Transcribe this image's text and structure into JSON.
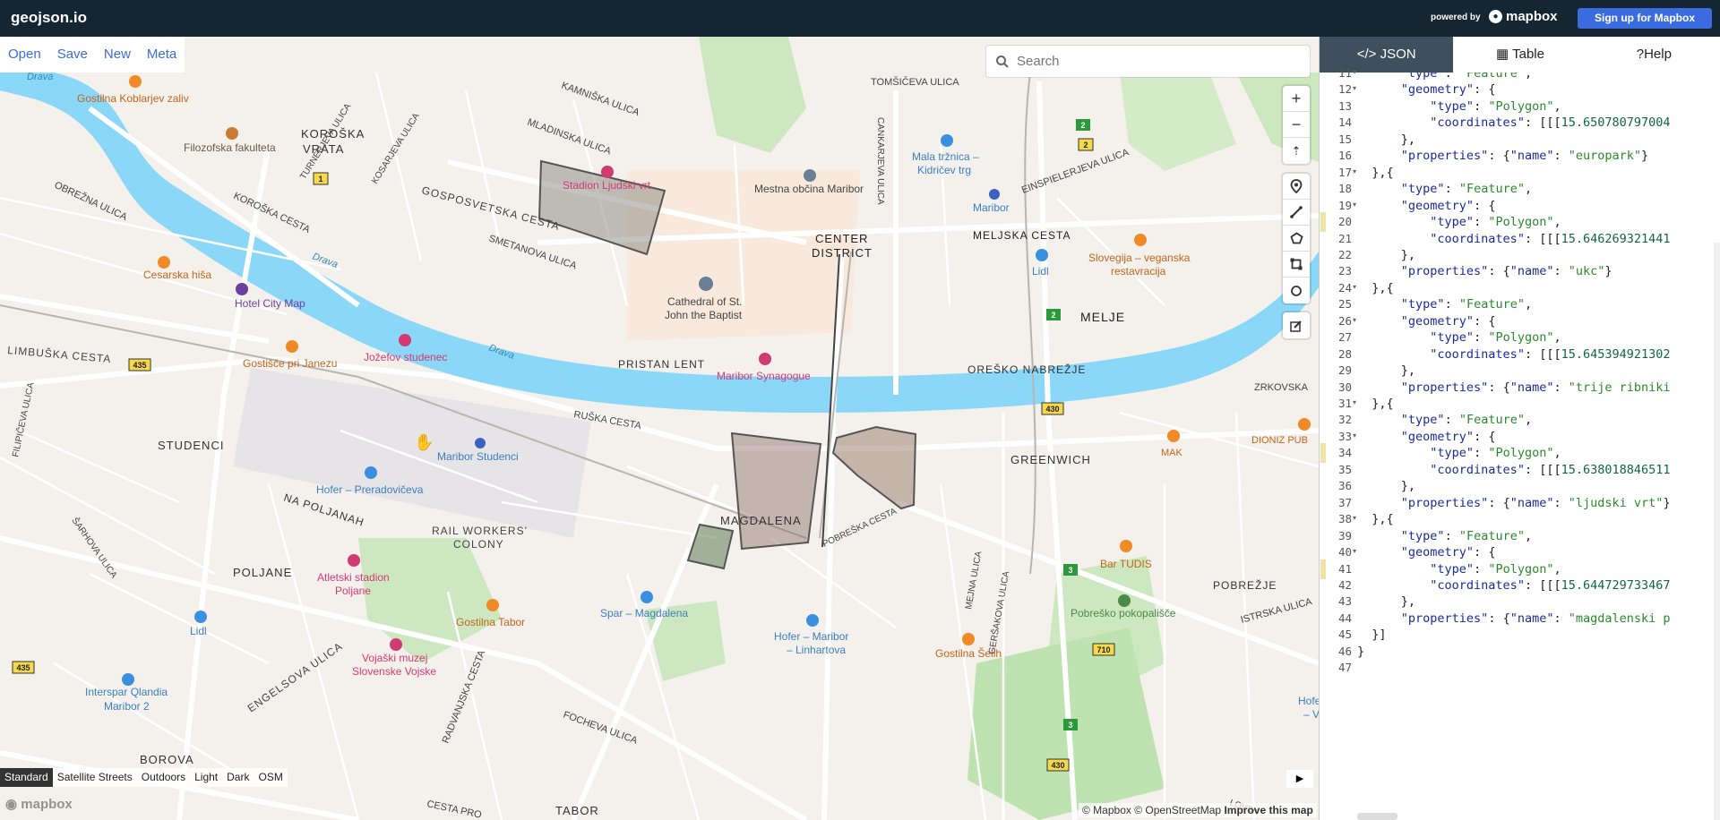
{
  "topbar": {
    "app_title": "geojson.io",
    "powered_by": "powered by",
    "brand": "mapbox",
    "signup_label": "Sign up for Mapbox"
  },
  "file_menu": [
    "Open",
    "Save",
    "New",
    "Meta"
  ],
  "search": {
    "placeholder": "Search"
  },
  "map_controls": {
    "zoom": [
      "+",
      "−",
      "⇡"
    ],
    "draw": [
      "marker-icon",
      "line-icon",
      "polygon-icon",
      "rectangle-icon",
      "circle-icon"
    ],
    "edit": [
      "edit-icon"
    ]
  },
  "map_styles": [
    "Standard",
    "Satellite Streets",
    "Outdoors",
    "Light",
    "Dark",
    "OSM"
  ],
  "attribution": {
    "mapbox": "© Mapbox",
    "osm": "© OpenStreetMap",
    "improve": "Improve this map"
  },
  "watermark": "mapbox",
  "map_labels": [
    "Drava",
    "Gostilna Koblarjev zaliv",
    "Filozofska fakulteta",
    "KOROŠKA",
    "VRATA",
    "TURNERJEVA ULICA",
    "KOSARJEVA ULICA",
    "MLADINSKA ULICA",
    "KAMNIŠKA ULICA",
    "Stadion Ljudski vrt",
    "TOMŠIČEVA ULICA",
    "CANKARJEVA ULICA",
    "Mala tržnica –",
    "Kidričev trg",
    "EINSPIELERJEVA ULICA",
    "Mestna občina Maribor",
    "Maribor",
    "OBREŽNA ULICA",
    "KOROŠKA CESTA",
    "GOSPOSVETSKA CESTA",
    "SMETANOVA ULICA",
    "CENTER",
    "DISTRICT",
    "MELJSKA CESTA",
    "Slovegija – veganska",
    "restavracija",
    "Lidl",
    "Cesarska hiša",
    "Hotel City Map",
    "Cathedral of St.",
    "John the Baptist",
    "MELJE",
    "LIMBUŠKA CESTA",
    "Gostišče pri Janezu",
    "Jožefov studenec",
    "PRISTAN LENT",
    "Maribor Synagogue",
    "OREŠKO NABREŽJE",
    "ZRKOVSKA",
    "RUŠKA CESTA",
    "STUDENCI",
    "Maribor Studenci",
    "DIONIZ PUB",
    "GREENWICH",
    "MAK",
    "Hofer – Preradovičeva",
    "NA POLJANAH",
    "MAGDALENA",
    "POBREŠKA CESTA",
    "RAIL WORKERS'",
    "COLONY",
    "Bar TUDIS",
    "POLJANE",
    "Atletski stadion",
    "Poljane",
    "Gostilna Tabor",
    "Spar – Magdalena",
    "Pobreško pokopališče",
    "POBREŽJE",
    "ISTRSKA ULICA",
    "Lidl",
    "ENGELSOVA ULICA",
    "Hofer – Maribor",
    "– Linhartova",
    "Gostilna Šelih",
    "Vojaški muzej",
    "Slovenske Vojske",
    "Interspar Qlandia",
    "Maribor 2",
    "FOCHEVA ULICA",
    "RADVANJSKA CESTA",
    "BOROVA",
    "TABOR",
    "CESTA PRO",
    "Drava",
    "Drava",
    "FILIPIČEVA ULICA",
    "ŠARHOVA ULICA",
    "MEJNA ULICA",
    "GERŠAKOVA ULICA",
    "Hofe",
    "– V",
    "LOVSK"
  ],
  "road_shields": [
    "1",
    "2",
    "2",
    "2",
    "435",
    "430",
    "3",
    "710",
    "3",
    "430",
    "435"
  ],
  "panel": {
    "tabs": [
      {
        "icon": "code-icon",
        "label": "JSON"
      },
      {
        "icon": "table-icon",
        "label": "Table"
      },
      {
        "icon": "help-icon",
        "label": "Help"
      }
    ],
    "code_lines": [
      {
        "n": "11",
        "fold": "▾",
        "text": "      \"type\": \"Feature\","
      },
      {
        "n": "12",
        "fold": "▾",
        "text": "      \"geometry\": {"
      },
      {
        "n": "13",
        "fold": "",
        "text": "          \"type\": \"Polygon\","
      },
      {
        "n": "14",
        "fold": "",
        "text": "          \"coordinates\": [[[15.650780797004"
      },
      {
        "n": "15",
        "fold": "",
        "text": "      },"
      },
      {
        "n": "16",
        "fold": "",
        "text": "      \"properties\": {\"name\": \"europark\"}"
      },
      {
        "n": "17",
        "fold": "▾",
        "text": "  },{"
      },
      {
        "n": "18",
        "fold": "",
        "text": "      \"type\": \"Feature\","
      },
      {
        "n": "19",
        "fold": "▾",
        "text": "      \"geometry\": {"
      },
      {
        "n": "20",
        "fold": "",
        "text": "          \"type\": \"Polygon\","
      },
      {
        "n": "21",
        "fold": "",
        "text": "          \"coordinates\": [[[15.646269321441"
      },
      {
        "n": "22",
        "fold": "",
        "text": "      },"
      },
      {
        "n": "23",
        "fold": "",
        "text": "      \"properties\": {\"name\": \"ukc\"}"
      },
      {
        "n": "24",
        "fold": "▾",
        "text": "  },{"
      },
      {
        "n": "25",
        "fold": "",
        "text": "      \"type\": \"Feature\","
      },
      {
        "n": "26",
        "fold": "▾",
        "text": "      \"geometry\": {"
      },
      {
        "n": "27",
        "fold": "",
        "text": "          \"type\": \"Polygon\","
      },
      {
        "n": "28",
        "fold": "",
        "text": "          \"coordinates\": [[[15.645394921302"
      },
      {
        "n": "29",
        "fold": "",
        "text": "      },"
      },
      {
        "n": "30",
        "fold": "",
        "text": "      \"properties\": {\"name\": \"trije ribniki"
      },
      {
        "n": "31",
        "fold": "▾",
        "text": "  },{"
      },
      {
        "n": "32",
        "fold": "",
        "text": "      \"type\": \"Feature\","
      },
      {
        "n": "33",
        "fold": "▾",
        "text": "      \"geometry\": {"
      },
      {
        "n": "34",
        "fold": "",
        "text": "          \"type\": \"Polygon\","
      },
      {
        "n": "35",
        "fold": "",
        "text": "          \"coordinates\": [[[15.638018846511"
      },
      {
        "n": "36",
        "fold": "",
        "text": "      },"
      },
      {
        "n": "37",
        "fold": "",
        "text": "      \"properties\": {\"name\": \"ljudski vrt\"}"
      },
      {
        "n": "38",
        "fold": "▾",
        "text": "  },{"
      },
      {
        "n": "39",
        "fold": "",
        "text": "      \"type\": \"Feature\","
      },
      {
        "n": "40",
        "fold": "▾",
        "text": "      \"geometry\": {"
      },
      {
        "n": "41",
        "fold": "",
        "text": "          \"type\": \"Polygon\","
      },
      {
        "n": "42",
        "fold": "",
        "text": "          \"coordinates\": [[[15.644729733467"
      },
      {
        "n": "43",
        "fold": "",
        "text": "      },"
      },
      {
        "n": "44",
        "fold": "",
        "text": "      \"properties\": {\"name\": \"magdalenski p"
      },
      {
        "n": "45",
        "fold": "",
        "text": "  }]"
      },
      {
        "n": "46",
        "fold": "",
        "text": "}"
      },
      {
        "n": "47",
        "fold": "",
        "text": ""
      }
    ]
  }
}
